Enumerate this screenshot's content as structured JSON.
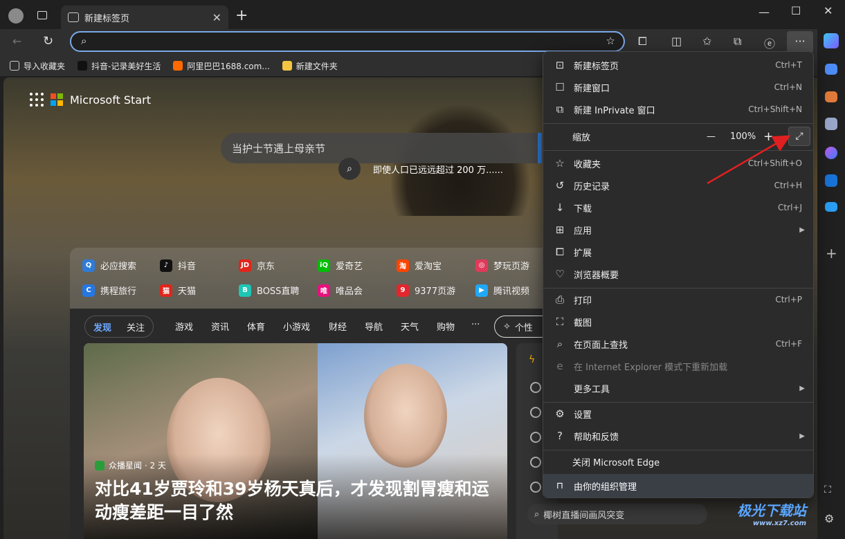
{
  "browser": {
    "tab_title": "新建标签页",
    "new_tab_symbol": "+"
  },
  "bookmarks": [
    {
      "label": "导入收藏夹",
      "color": "#cccccc"
    },
    {
      "label": "抖音-记录美好生活",
      "color": "#111111"
    },
    {
      "label": "阿里巴巴1688.com...",
      "color": "#ff6a00"
    },
    {
      "label": "新建文件夹",
      "color": "#f4c542"
    }
  ],
  "newtab": {
    "brand": "Microsoft Start",
    "search_text": "当护士节遇上母亲节",
    "hint_text": "即使人口已远远超过 200 万......",
    "quick_links": [
      {
        "label": "必应搜索",
        "color": "#2f7bd8",
        "glyph": "Q"
      },
      {
        "label": "抖音",
        "color": "#111111",
        "glyph": "♪"
      },
      {
        "label": "京东",
        "color": "#e1251b",
        "glyph": "JD"
      },
      {
        "label": "爱奇艺",
        "color": "#00be06",
        "glyph": "iQ"
      },
      {
        "label": "爱淘宝",
        "color": "#ff4400",
        "glyph": "淘"
      },
      {
        "label": "梦玩页游",
        "color": "#e03a5a",
        "glyph": "◎"
      },
      {
        "label": "携程旅行",
        "color": "#2577e3",
        "glyph": "C"
      },
      {
        "label": "天猫",
        "color": "#e1251b",
        "glyph": "猫"
      },
      {
        "label": "BOSS直聘",
        "color": "#1ec6b5",
        "glyph": "B"
      },
      {
        "label": "唯品会",
        "color": "#e6127c",
        "glyph": "唯"
      },
      {
        "label": "9377页游",
        "color": "#e3262d",
        "glyph": "9"
      },
      {
        "label": "腾讯视频",
        "color": "#20a7f5",
        "glyph": "▶"
      }
    ],
    "feed_tabs": [
      "发现",
      "关注"
    ],
    "feed_nav": [
      "游戏",
      "资讯",
      "体育",
      "小游戏",
      "财经",
      "导航",
      "天气",
      "购物",
      "···"
    ],
    "personalize_label": "个性",
    "article": {
      "source": "众播星闻 · 2 天",
      "headline": "对比41岁贾玲和39岁杨天真后，才发现割胃瘦和运动瘦差距一目了然"
    },
    "bottom_search": "椰树直播间画风突变"
  },
  "menu": {
    "items": [
      {
        "icon": "new-tab-icon",
        "glyph": "⊡",
        "label": "新建标签页",
        "shortcut": "Ctrl+T"
      },
      {
        "icon": "new-window-icon",
        "glyph": "☐",
        "label": "新建窗口",
        "shortcut": "Ctrl+N"
      },
      {
        "icon": "inprivate-icon",
        "glyph": "⧉",
        "label": "新建 InPrivate 窗口",
        "shortcut": "Ctrl+Shift+N"
      }
    ],
    "zoom": {
      "label": "缩放",
      "minus": "—",
      "value": "100%",
      "plus": "+"
    },
    "items2": [
      {
        "icon": "favorites-icon",
        "glyph": "☆",
        "label": "收藏夹",
        "shortcut": "Ctrl+Shift+O"
      },
      {
        "icon": "history-icon",
        "glyph": "↺",
        "label": "历史记录",
        "shortcut": "Ctrl+H"
      },
      {
        "icon": "download-icon",
        "glyph": "↓",
        "label": "下载",
        "shortcut": "Ctrl+J"
      },
      {
        "icon": "apps-icon",
        "glyph": "⊞",
        "label": "应用",
        "shortcut": ""
      },
      {
        "icon": "extensions-icon",
        "glyph": "⧠",
        "label": "扩展",
        "shortcut": ""
      },
      {
        "icon": "essentials-icon",
        "glyph": "♡",
        "label": "浏览器概要",
        "shortcut": ""
      }
    ],
    "items3": [
      {
        "icon": "print-icon",
        "glyph": "⎙",
        "label": "打印",
        "shortcut": "Ctrl+P"
      },
      {
        "icon": "screenshot-icon",
        "glyph": "⛶",
        "label": "截图",
        "shortcut": ""
      },
      {
        "icon": "find-icon",
        "glyph": "⌕",
        "label": "在页面上查找",
        "shortcut": "Ctrl+F"
      },
      {
        "icon": "ie-mode-icon",
        "glyph": "e",
        "label": "在 Internet Explorer 模式下重新加载",
        "shortcut": ""
      },
      {
        "icon": "more-tools-icon",
        "glyph": "",
        "label": "更多工具",
        "shortcut": ""
      }
    ],
    "items4": [
      {
        "icon": "settings-icon",
        "glyph": "⚙",
        "label": "设置",
        "shortcut": ""
      },
      {
        "icon": "help-icon",
        "glyph": "?",
        "label": "帮助和反馈",
        "shortcut": ""
      }
    ],
    "close_label": "关闭 Microsoft Edge",
    "managed_label": "由你的组织管理"
  },
  "watermark": {
    "main": "极光下载站",
    "sub": "www.xz7.com"
  }
}
